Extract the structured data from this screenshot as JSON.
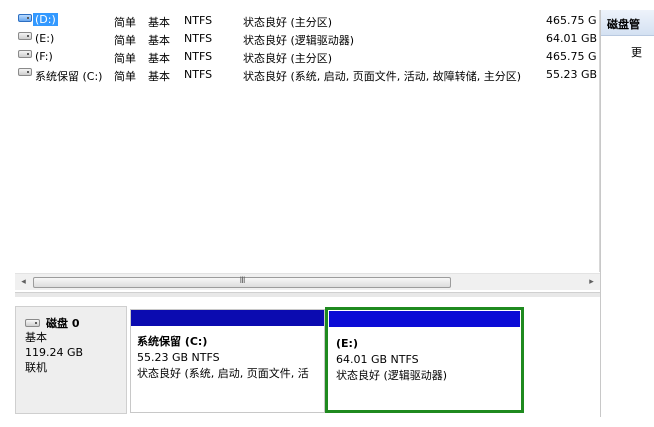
{
  "volumes": [
    {
      "name": "(D:)",
      "layout": "简单",
      "type": "基本",
      "fs": "NTFS",
      "status": "状态良好 (主分区)",
      "capacity": "465.75 G",
      "selected": true
    },
    {
      "name": "(E:)",
      "layout": "简单",
      "type": "基本",
      "fs": "NTFS",
      "status": "状态良好 (逻辑驱动器)",
      "capacity": "64.01 GB",
      "selected": false
    },
    {
      "name": "(F:)",
      "layout": "简单",
      "type": "基本",
      "fs": "NTFS",
      "status": "状态良好 (主分区)",
      "capacity": "465.75 G",
      "selected": false
    },
    {
      "name": "系统保留 (C:)",
      "layout": "简单",
      "type": "基本",
      "fs": "NTFS",
      "status": "状态良好 (系统, 启动, 页面文件, 活动, 故障转储, 主分区)",
      "capacity": "55.23 GB",
      "selected": false
    }
  ],
  "scrollbar": {
    "left_arrow": "◂",
    "right_arrow": "▸",
    "grip": "III"
  },
  "disk": {
    "title": "磁盘 0",
    "type": "基本",
    "size": "119.24 GB",
    "state": "联机"
  },
  "partitions": {
    "c": {
      "name": "系统保留  (C:)",
      "size_fs": "55.23 GB NTFS",
      "status": "状态良好 (系统, 启动, 页面文件, 活"
    },
    "e": {
      "name": "(E:)",
      "size_fs": "64.01 GB NTFS",
      "status": "状态良好 (逻辑驱动器)"
    }
  },
  "right_panel": {
    "header": "磁盘管",
    "more": "更"
  },
  "colors": {
    "selection": "#3399ff",
    "partition_bar": "#0b0bb0",
    "selected_partition_border": "#1f8a1f"
  }
}
